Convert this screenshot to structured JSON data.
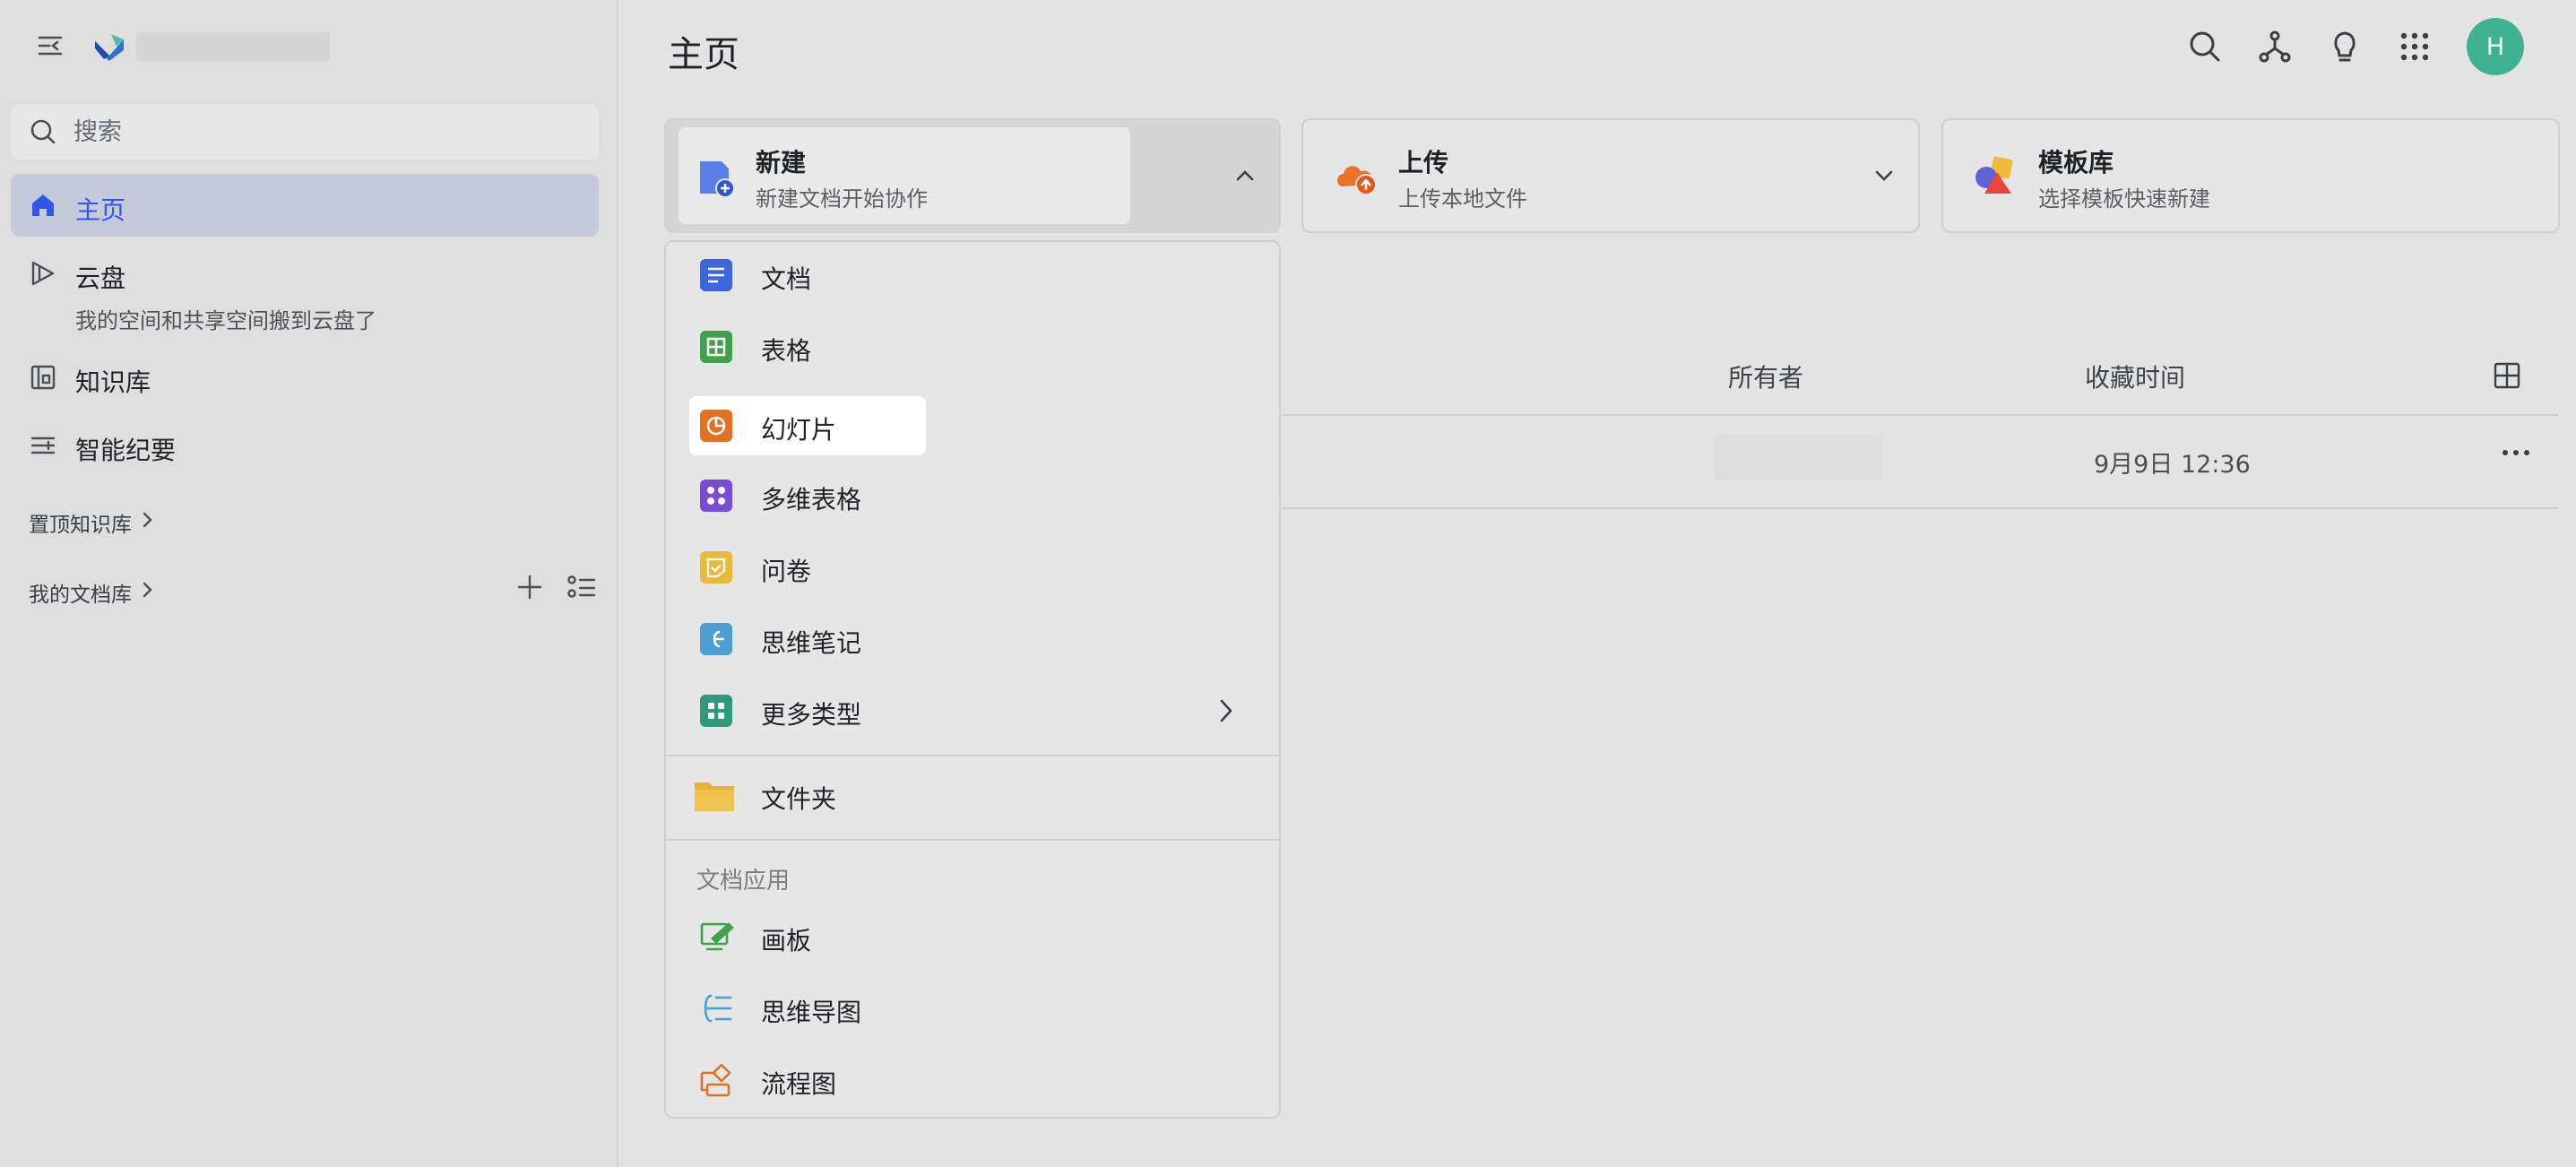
{
  "sidebar": {
    "search_placeholder": "搜索",
    "nav": [
      {
        "label": "主页",
        "icon": "home-icon",
        "active": true
      },
      {
        "label": "云盘",
        "icon": "cloud-drive-icon",
        "sub": "我的空间和共享空间搬到云盘了"
      },
      {
        "label": "知识库",
        "icon": "knowledge-base-icon"
      },
      {
        "label": "智能纪要",
        "icon": "smart-minutes-icon"
      }
    ],
    "pinned_kb": "置顶知识库",
    "my_library": "我的文档库"
  },
  "header": {
    "title": "主页",
    "avatar_initial": "H"
  },
  "quick_actions": {
    "new": {
      "title": "新建",
      "sub": "新建文档开始协作"
    },
    "upload": {
      "title": "上传",
      "sub": "上传本地文件"
    },
    "template": {
      "title": "模板库",
      "sub": "选择模板快速新建"
    }
  },
  "table": {
    "col_owner": "所有者",
    "col_time": "收藏时间",
    "rows": [
      {
        "time": "9月9日 12:36"
      }
    ]
  },
  "dropdown": {
    "items": [
      "文档",
      "表格",
      "幻灯片",
      "多维表格",
      "问卷",
      "思维笔记",
      "更多类型"
    ],
    "folder": "文件夹",
    "section_title": "文档应用",
    "apps": [
      "画板",
      "思维导图",
      "流程图"
    ]
  },
  "colors": {
    "accent": "#3356e6",
    "active_bg": "#c5c9dc",
    "avatar": "#3fb391",
    "doc": "#3c66e0",
    "sheet": "#3fa14a",
    "slides": "#e37125",
    "base": "#7a4cd6",
    "survey": "#e8b93a",
    "mindnote": "#4b9fd5",
    "more": "#2f9a7a",
    "folder": "#e8b23a"
  }
}
